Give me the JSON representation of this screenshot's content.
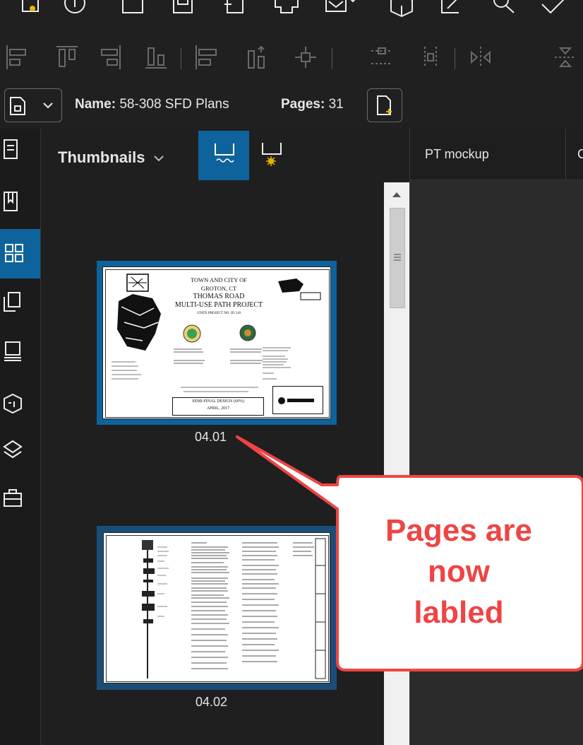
{
  "toolbar": {
    "row1_icons": [
      "new-file-icon",
      "add-circle-icon",
      "page-icon",
      "save-icon",
      "file-export-icon",
      "print-icon",
      "email-icon",
      "box-3d-icon",
      "edit-icon",
      "search-icon",
      "check-icon"
    ],
    "row2_icons": [
      "align-left-icon",
      "align-top-icon",
      "align-right-icon",
      "align-bottom-icon",
      "distribute-horizontal-icon",
      "distribute-vertical-icon",
      "center-icon",
      "grid-horizontal-icon",
      "grid-vertical-icon",
      "flip-horizontal-icon",
      "flip-vertical-icon"
    ]
  },
  "document_bar": {
    "name_label": "Name:",
    "name_value": "58-308 SFD Plans",
    "pages_label": "Pages:",
    "pages_value": "31"
  },
  "thumbnails_panel": {
    "title": "Thumbnails",
    "pages": [
      {
        "label": "04.01",
        "selected": true,
        "sheet": {
          "title_lines": [
            "TOWN AND CITY OF",
            "GROTON, CT",
            "THOMAS ROAD",
            "MULTI-USE PATH PROJECT",
            "STATE PROJECT NO. ID 318"
          ],
          "footer_lines": [
            "SEMI-FINAL DESIGN (60%)",
            "APRIL, 2017"
          ]
        }
      },
      {
        "label": "04.02",
        "selected": false
      }
    ]
  },
  "tabs": [
    {
      "label": "PT mockup"
    },
    {
      "label": "C"
    }
  ],
  "callout": {
    "text_lines": [
      "Pages are",
      "now",
      "labled"
    ]
  },
  "colors": {
    "accent_blue": "#0e639c",
    "callout_border": "#ef4444",
    "callout_text": "#ef4444",
    "star_yellow": "#e8b400"
  }
}
